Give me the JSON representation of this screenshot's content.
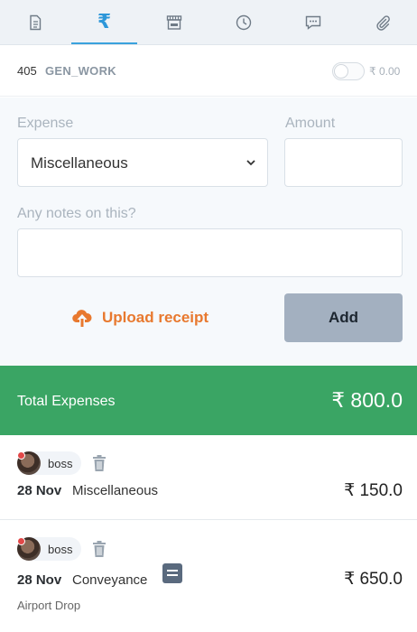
{
  "tabs": [
    {
      "name": "document",
      "icon": "document-icon"
    },
    {
      "name": "expenses",
      "icon": "rupee-icon",
      "glyph": "₹"
    },
    {
      "name": "store",
      "icon": "storefront-icon"
    },
    {
      "name": "time",
      "icon": "clock-icon"
    },
    {
      "name": "chat",
      "icon": "chat-icon"
    },
    {
      "name": "attachments",
      "icon": "paperclip-icon"
    }
  ],
  "job": {
    "number": "405",
    "name": "GEN_WORK",
    "toggle_amount": "₹ 0.00"
  },
  "form": {
    "expense_label": "Expense",
    "expense_value": "Miscellaneous",
    "amount_label": "Amount",
    "amount_value": "",
    "notes_label": "Any notes on this?",
    "notes_value": "",
    "upload_label": "Upload receipt",
    "add_label": "Add"
  },
  "total": {
    "label": "Total Expenses",
    "amount": "₹ 800.0"
  },
  "expenses": [
    {
      "user": "boss",
      "date": "28 Nov",
      "category": "Miscellaneous",
      "amount": "₹ 150.0",
      "note": "",
      "has_receipt": false
    },
    {
      "user": "boss",
      "date": "28 Nov",
      "category": "Conveyance",
      "amount": "₹ 650.0",
      "note": "Airport Drop",
      "has_receipt": true
    }
  ],
  "colors": {
    "accent": "#3aa2dd",
    "total_bg": "#3aa564",
    "upload": "#e8792f",
    "add_btn": "#a3b0c0"
  }
}
